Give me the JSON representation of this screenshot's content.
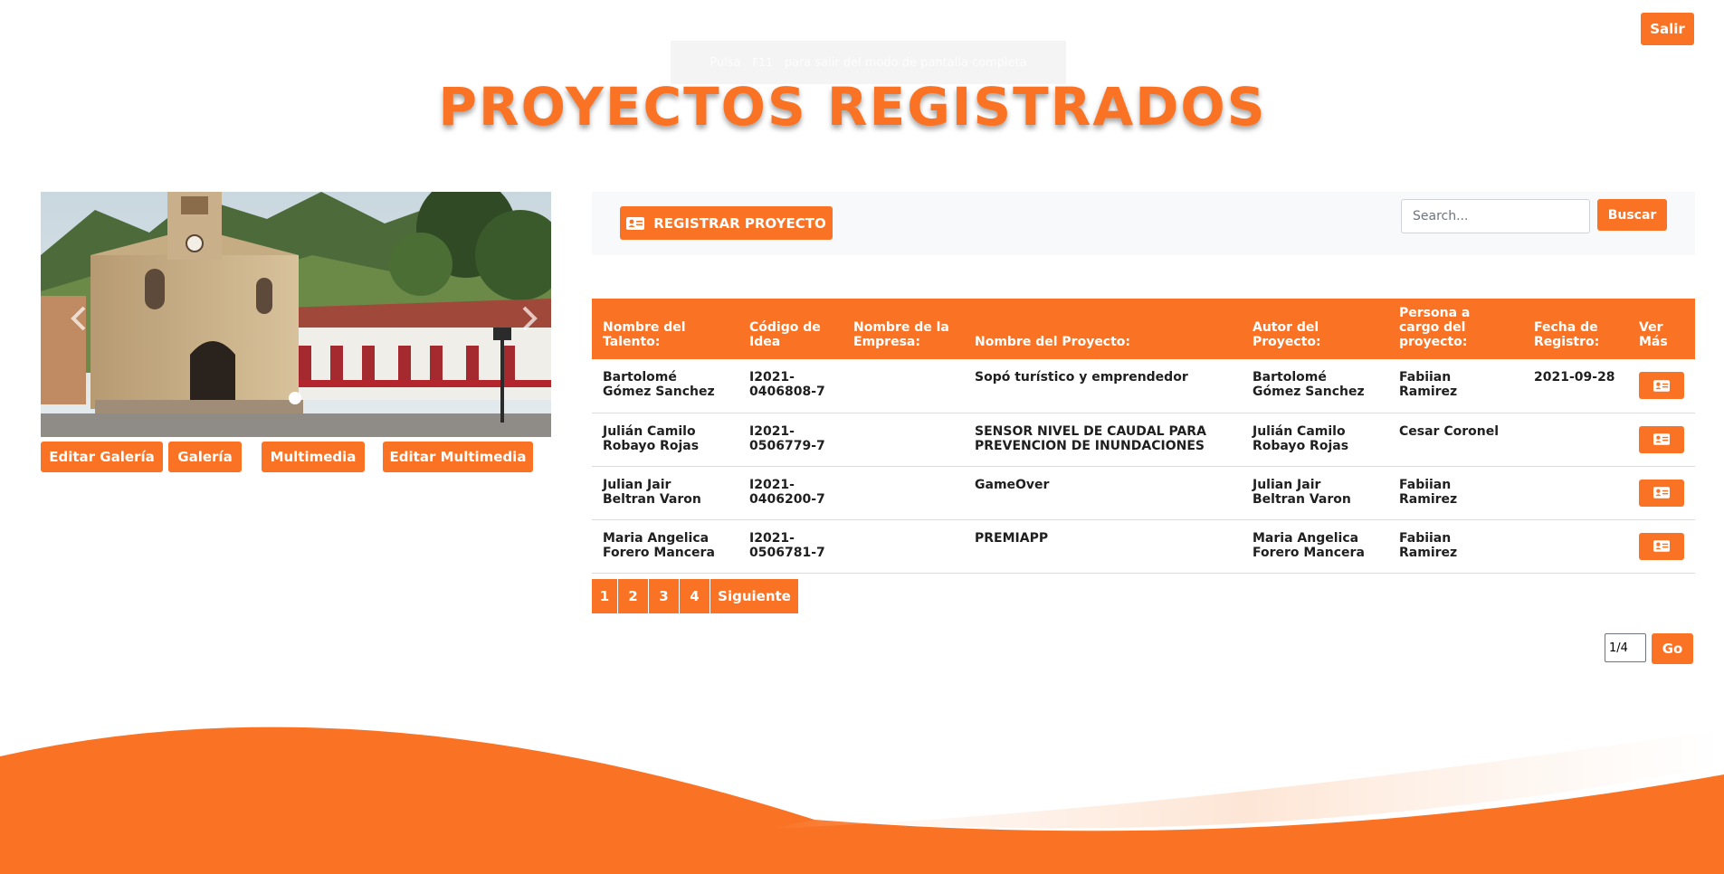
{
  "header": {
    "logout_label": "Salir",
    "title": "PROYECTOS REGISTRADOS",
    "fullscreen_hint": {
      "before": "Pulsa",
      "key": "F11",
      "after": "para salir del modo de pantalla completa"
    }
  },
  "carousel": {
    "prev_icon": "chevron-left-icon",
    "next_icon": "chevron-right-icon",
    "slides": 1,
    "active_slide": 1
  },
  "gallery_buttons": {
    "edit_gallery": "Editar Galería",
    "gallery": "Galería",
    "multimedia": "Multimedia",
    "edit_multimedia": "Editar Multimedia"
  },
  "toolbar": {
    "register_label": "REGISTRAR PROYECTO",
    "register_icon": "id-card-icon",
    "search_placeholder": "Search...",
    "search_button": "Buscar"
  },
  "table": {
    "headers": [
      "Nombre del Talento:",
      "Código de Idea",
      "Nombre de la Empresa:",
      "Nombre del Proyecto:",
      "Autor del Proyecto:",
      "Persona a cargo del proyecto:",
      "Fecha de Registro:",
      "Ver Más"
    ],
    "rows": [
      {
        "talent": "Bartolomé Gómez Sanchez",
        "idea_code": "I2021-0406808-7",
        "company": "",
        "project": "Sopó turístico y emprendedor",
        "author": "Bartolomé Gómez Sanchez",
        "manager": "Fabiian Ramirez",
        "date": "2021-09-28"
      },
      {
        "talent": "Julián Camilo Robayo Rojas",
        "idea_code": "I2021-0506779-7",
        "company": "",
        "project": "SENSOR NIVEL DE CAUDAL PARA PREVENCION DE INUNDACIONES",
        "author": "Julián Camilo Robayo Rojas",
        "manager": "Cesar Coronel",
        "date": ""
      },
      {
        "talent": "Julian Jair Beltran Varon",
        "idea_code": "I2021-0406200-7",
        "company": "",
        "project": "GameOver",
        "author": "Julian Jair Beltran Varon",
        "manager": "Fabiian Ramirez",
        "date": ""
      },
      {
        "talent": "Maria Angelica Forero Mancera",
        "idea_code": "I2021-0506781-7",
        "company": "",
        "project": "PREMIAPP",
        "author": "Maria Angelica Forero Mancera",
        "manager": "Fabiian Ramirez",
        "date": ""
      }
    ],
    "view_icon": "id-card-icon"
  },
  "pagination": {
    "pages": [
      "1",
      "2",
      "3",
      "4"
    ],
    "next_label": "Siguiente",
    "page_input_value": "1/4",
    "go_label": "Go"
  },
  "colors": {
    "accent": "#fa7324",
    "toolbar_bg": "#f8f9fa"
  }
}
